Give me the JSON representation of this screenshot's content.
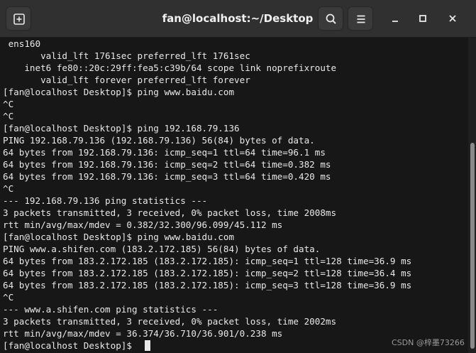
{
  "window": {
    "title": "fan@localhost:~/Desktop"
  },
  "icons": {
    "new_tab": "new-tab-icon",
    "search": "search-icon",
    "menu": "hamburger-menu-icon",
    "minimize": "minimize-icon",
    "maximize": "maximize-icon",
    "close": "close-icon"
  },
  "terminal": {
    "lines": [
      " ens160",
      "       valid_lft 1761sec preferred_lft 1761sec",
      "    inet6 fe80::20c:29ff:fea5:c39b/64 scope link noprefixroute",
      "       valid_lft forever preferred_lft forever",
      "[fan@localhost Desktop]$ ping www.baidu.com",
      "^C",
      "^C",
      "[fan@localhost Desktop]$ ping 192.168.79.136",
      "PING 192.168.79.136 (192.168.79.136) 56(84) bytes of data.",
      "64 bytes from 192.168.79.136: icmp_seq=1 ttl=64 time=96.1 ms",
      "64 bytes from 192.168.79.136: icmp_seq=2 ttl=64 time=0.382 ms",
      "64 bytes from 192.168.79.136: icmp_seq=3 ttl=64 time=0.420 ms",
      "^C",
      "--- 192.168.79.136 ping statistics ---",
      "3 packets transmitted, 3 received, 0% packet loss, time 2008ms",
      "rtt min/avg/max/mdev = 0.382/32.300/96.099/45.112 ms",
      "[fan@localhost Desktop]$ ping www.baidu.com",
      "PING www.a.shifen.com (183.2.172.185) 56(84) bytes of data.",
      "64 bytes from 183.2.172.185 (183.2.172.185): icmp_seq=1 ttl=128 time=36.9 ms",
      "64 bytes from 183.2.172.185 (183.2.172.185): icmp_seq=2 ttl=128 time=36.4 ms",
      "64 bytes from 183.2.172.185 (183.2.172.185): icmp_seq=3 ttl=128 time=36.9 ms",
      "^C",
      "--- www.a.shifen.com ping statistics ---",
      "3 packets transmitted, 3 received, 0% packet loss, time 2002ms",
      "rtt min/avg/max/mdev = 36.374/36.710/36.901/0.238 ms",
      "[fan@localhost Desktop]$ "
    ]
  },
  "watermark": {
    "text": "CSDN @梓墨73266"
  }
}
